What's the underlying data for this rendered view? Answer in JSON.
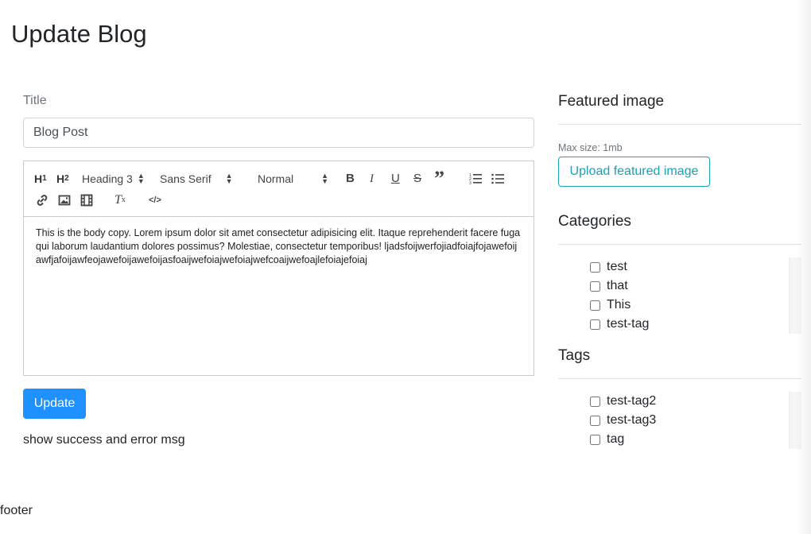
{
  "page": {
    "title": "Update Blog"
  },
  "form": {
    "title_label": "Title",
    "title_value": "Blog Post",
    "update_label": "Update",
    "message": "show success and error msg"
  },
  "editor": {
    "toolbar": {
      "h1": "H",
      "h1_sub": "1",
      "h2": "H",
      "h2_sub": "2",
      "heading_picker": "Heading 3",
      "font_picker": "Sans Serif",
      "size_picker": "Normal",
      "bold": "B",
      "italic": "I",
      "underline": "U",
      "strike": "S",
      "blockquote": "”",
      "clean_text": "T",
      "clean_sub": "x",
      "code": "</>"
    },
    "body": "This is the body copy. Lorem ipsum dolor sit amet consectetur adipisicing elit. Itaque reprehenderit facere fuga qui laborum laudantium dolores possimus? Molestiae, consectetur temporibus! ljadsfoijwerfojiadfoiajfojawefoijawfjafoijawfeojawefoijawefoijasfoaijwefoiajwefoiajwefcoaijwefoajlefoiajefoiaj"
  },
  "sidebar": {
    "featured_heading": "Featured image",
    "max_size": "Max size: 1mb",
    "upload_label": "Upload featured image",
    "categories_heading": "Categories",
    "categories": [
      "test",
      "that",
      "This",
      "test-tag"
    ],
    "tags_heading": "Tags",
    "tags": [
      "test-tag2",
      "test-tag3",
      "tag"
    ]
  },
  "footer": {
    "text": "footer"
  },
  "colors": {
    "primary": "#1e90ff",
    "info": "#17a2b8",
    "muted": "#6c757d",
    "text": "#212529"
  }
}
